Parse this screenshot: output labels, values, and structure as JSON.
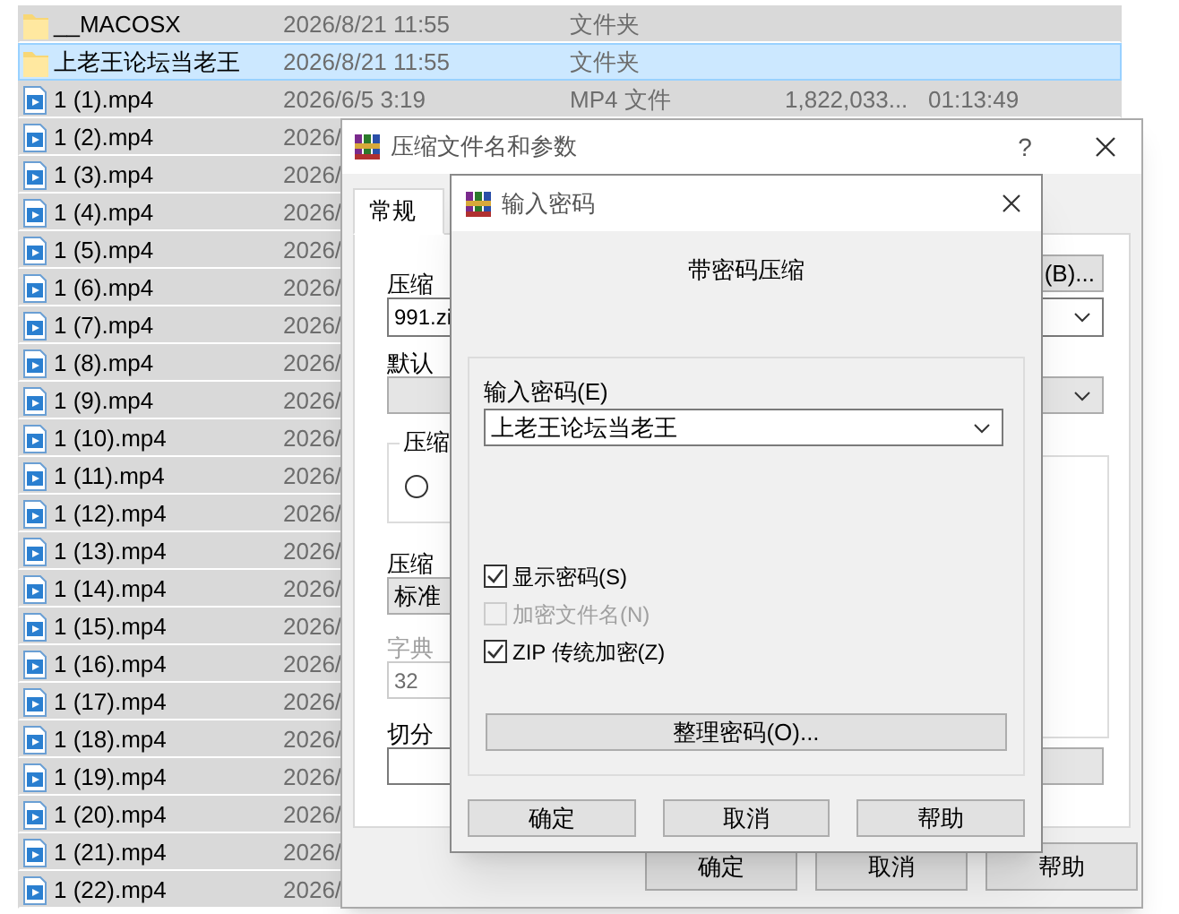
{
  "file_list": {
    "rows": [
      {
        "kind": "folder",
        "name": "__MACOSX",
        "date": "2026/8/21 11:55",
        "type": "文件夹",
        "selected": false
      },
      {
        "kind": "folder",
        "name": "上老王论坛当老王",
        "date": "2026/8/21 11:55",
        "type": "文件夹",
        "selected": true
      },
      {
        "kind": "video",
        "name": "1 (1).mp4",
        "date": "2026/6/5 3:19",
        "type": "MP4 文件",
        "size": "1,822,033...",
        "duration": "01:13:49",
        "selected": false
      },
      {
        "kind": "video",
        "name": "1 (2).mp4",
        "date": "2026/",
        "selected": false
      },
      {
        "kind": "video",
        "name": "1 (3).mp4",
        "date": "2026/",
        "selected": false
      },
      {
        "kind": "video",
        "name": "1 (4).mp4",
        "date": "2026/",
        "selected": false
      },
      {
        "kind": "video",
        "name": "1 (5).mp4",
        "date": "2026/",
        "selected": false
      },
      {
        "kind": "video",
        "name": "1 (6).mp4",
        "date": "2026/",
        "selected": false
      },
      {
        "kind": "video",
        "name": "1 (7).mp4",
        "date": "2026/",
        "selected": false
      },
      {
        "kind": "video",
        "name": "1 (8).mp4",
        "date": "2026/",
        "selected": false
      },
      {
        "kind": "video",
        "name": "1 (9).mp4",
        "date": "2026/",
        "selected": false
      },
      {
        "kind": "video",
        "name": "1 (10).mp4",
        "date": "2026/",
        "selected": false
      },
      {
        "kind": "video",
        "name": "1 (11).mp4",
        "date": "2026/",
        "selected": false
      },
      {
        "kind": "video",
        "name": "1 (12).mp4",
        "date": "2026/",
        "selected": false
      },
      {
        "kind": "video",
        "name": "1 (13).mp4",
        "date": "2026/",
        "selected": false
      },
      {
        "kind": "video",
        "name": "1 (14).mp4",
        "date": "2026/",
        "selected": false
      },
      {
        "kind": "video",
        "name": "1 (15).mp4",
        "date": "2026/",
        "selected": false
      },
      {
        "kind": "video",
        "name": "1 (16).mp4",
        "date": "2026/",
        "selected": false
      },
      {
        "kind": "video",
        "name": "1 (17).mp4",
        "date": "2026/",
        "selected": false
      },
      {
        "kind": "video",
        "name": "1 (18).mp4",
        "date": "2026/",
        "selected": false
      },
      {
        "kind": "video",
        "name": "1 (19).mp4",
        "date": "2026/",
        "selected": false
      },
      {
        "kind": "video",
        "name": "1 (20).mp4",
        "date": "2026/",
        "selected": false
      },
      {
        "kind": "video",
        "name": "1 (21).mp4",
        "date": "2026/",
        "selected": false
      },
      {
        "kind": "video",
        "name": "1 (22).mp4",
        "date": "2026/",
        "selected": false
      }
    ]
  },
  "archive_dialog": {
    "title": "压缩文件名和参数",
    "help": "?",
    "tabs": [
      {
        "label": "常规",
        "selected": true
      }
    ],
    "archive_name_label": "压缩",
    "archive_name": "991.zi",
    "browse_button": "(B)...",
    "profile_label": "默认",
    "format_group_label": "压缩",
    "format_option": {
      "selected": false
    },
    "method_label": "压缩",
    "method": "标准",
    "dictionary": {
      "label": "字典",
      "value": "32",
      "disabled": true
    },
    "split_label": "切分",
    "buttons": [
      "确定",
      "取消",
      "帮助"
    ]
  },
  "password_dialog": {
    "title": "输入密码",
    "heading": "带密码压缩",
    "password_label": "输入密码(E)",
    "password": "上老王论坛当老王",
    "options": [
      {
        "label": "显示密码(S)",
        "checked": true,
        "disabled": false
      },
      {
        "label": "加密文件名(N)",
        "checked": false,
        "disabled": true
      },
      {
        "label": "ZIP 传统加密(Z)",
        "checked": true,
        "disabled": false
      }
    ],
    "organize_button": "整理密码(O)...",
    "buttons": [
      "确定",
      "取消",
      "帮助"
    ]
  }
}
